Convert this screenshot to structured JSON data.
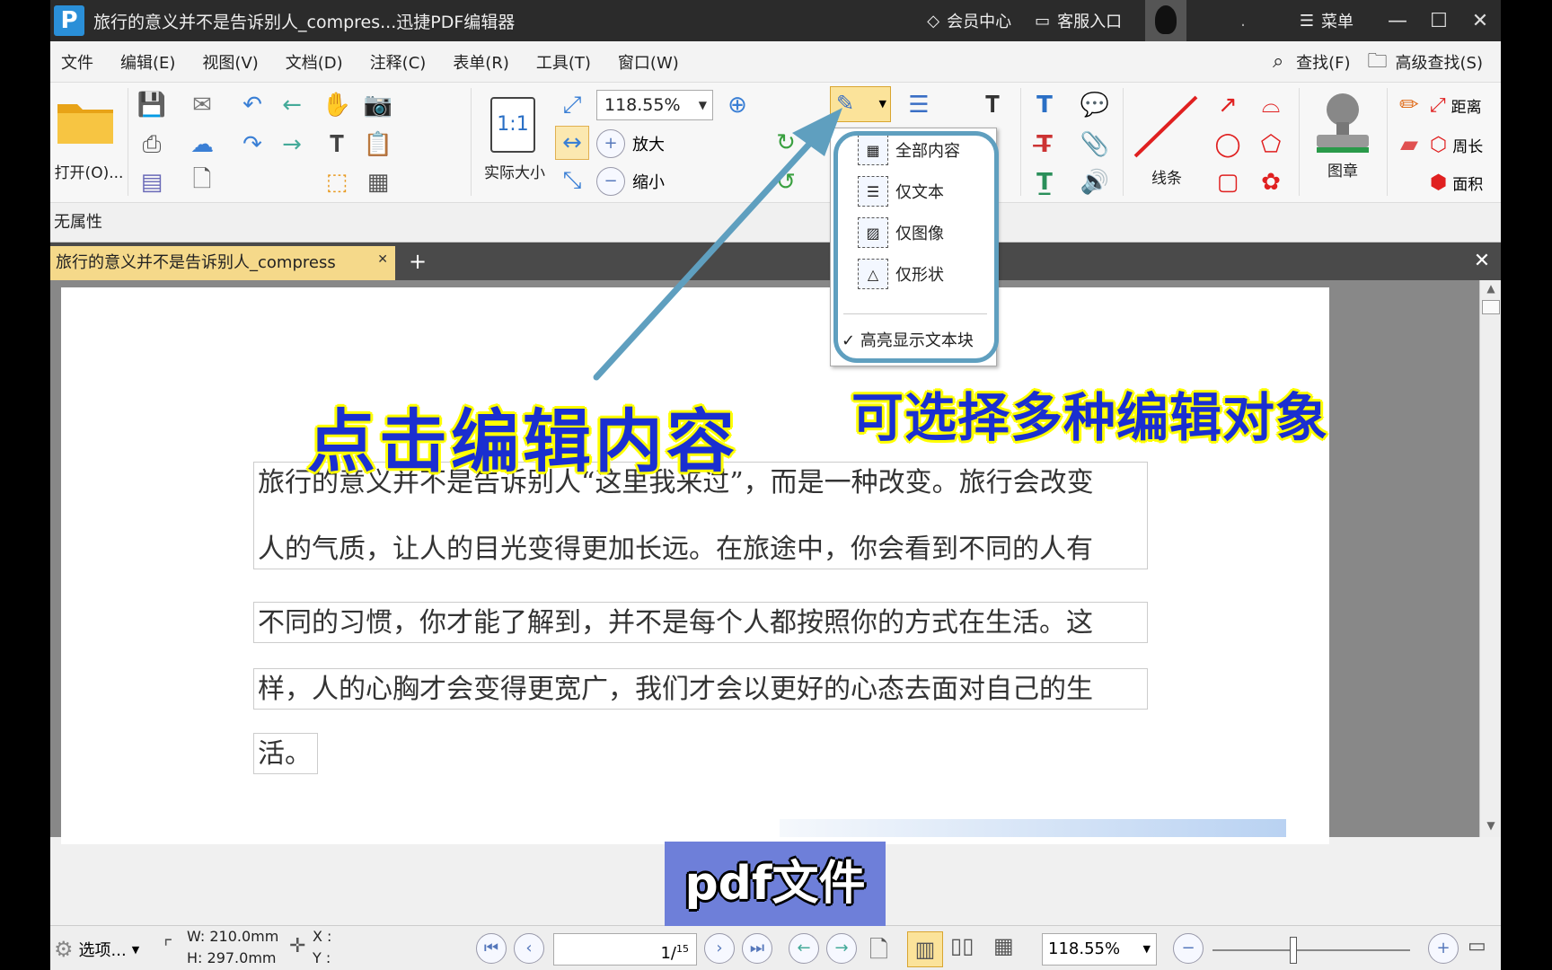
{
  "window": {
    "title": "旅行的意义并不是告诉别人_compres...迅捷PDF编辑器",
    "logo": "P",
    "member_center": "会员中心",
    "customer_service": "客服入口",
    "separator_dot": ".",
    "menu": "菜单"
  },
  "menubar": {
    "items": [
      "文件",
      "编辑(E)",
      "视图(V)",
      "文档(D)",
      "注释(C)",
      "表单(R)",
      "工具(T)",
      "窗口(W)"
    ],
    "find": "查找(F)",
    "advanced_find": "高级查找(S)"
  },
  "ribbon": {
    "open": "打开(O)...",
    "actual_size": "实际大小",
    "actual_size_icon_text": "1:1",
    "zoom_value": "118.55%",
    "zoom_in": "放大",
    "zoom_out": "缩小",
    "line": "线条",
    "stamp": "图章",
    "distance": "距离",
    "perimeter": "周长",
    "area": "面积"
  },
  "edit_dropdown": {
    "items": [
      "全部内容",
      "仅文本",
      "仅图像",
      "仅形状"
    ],
    "highlight_option": "高亮显示文本块"
  },
  "properties_bar": "无属性",
  "tabs": {
    "active_tab": "旅行的意义并不是告诉别人_compress"
  },
  "document": {
    "lines": [
      "旅行的意义并不是告诉别人“这里我来过”，而是一种改变。旅行会改变",
      "人的气质，让人的目光变得更加长远。在旅途中，你会看到不同的人有",
      "不同的习惯，你才能了解到，并不是每个人都按照你的方式在生活。这",
      "样，人的心胸才会变得更宽广，我们才会以更好的心态去面对自己的生",
      "活。"
    ]
  },
  "annotations": {
    "click_edit": "点击编辑内容",
    "multi_select": "可选择多种编辑对象",
    "subtitle": "pdf文件"
  },
  "statusbar": {
    "options": "选项...",
    "width": "W: 210.0mm",
    "height": "H: 297.0mm",
    "x": "X :",
    "y": "Y :",
    "page_current": "1",
    "page_total": "15",
    "zoom": "118.55%"
  },
  "colors": {
    "callout_text": "#1a2fd0",
    "callout_outline": "#ffff00",
    "highlight_ring": "#5f9fbf",
    "tab_active": "#f5d98a"
  }
}
